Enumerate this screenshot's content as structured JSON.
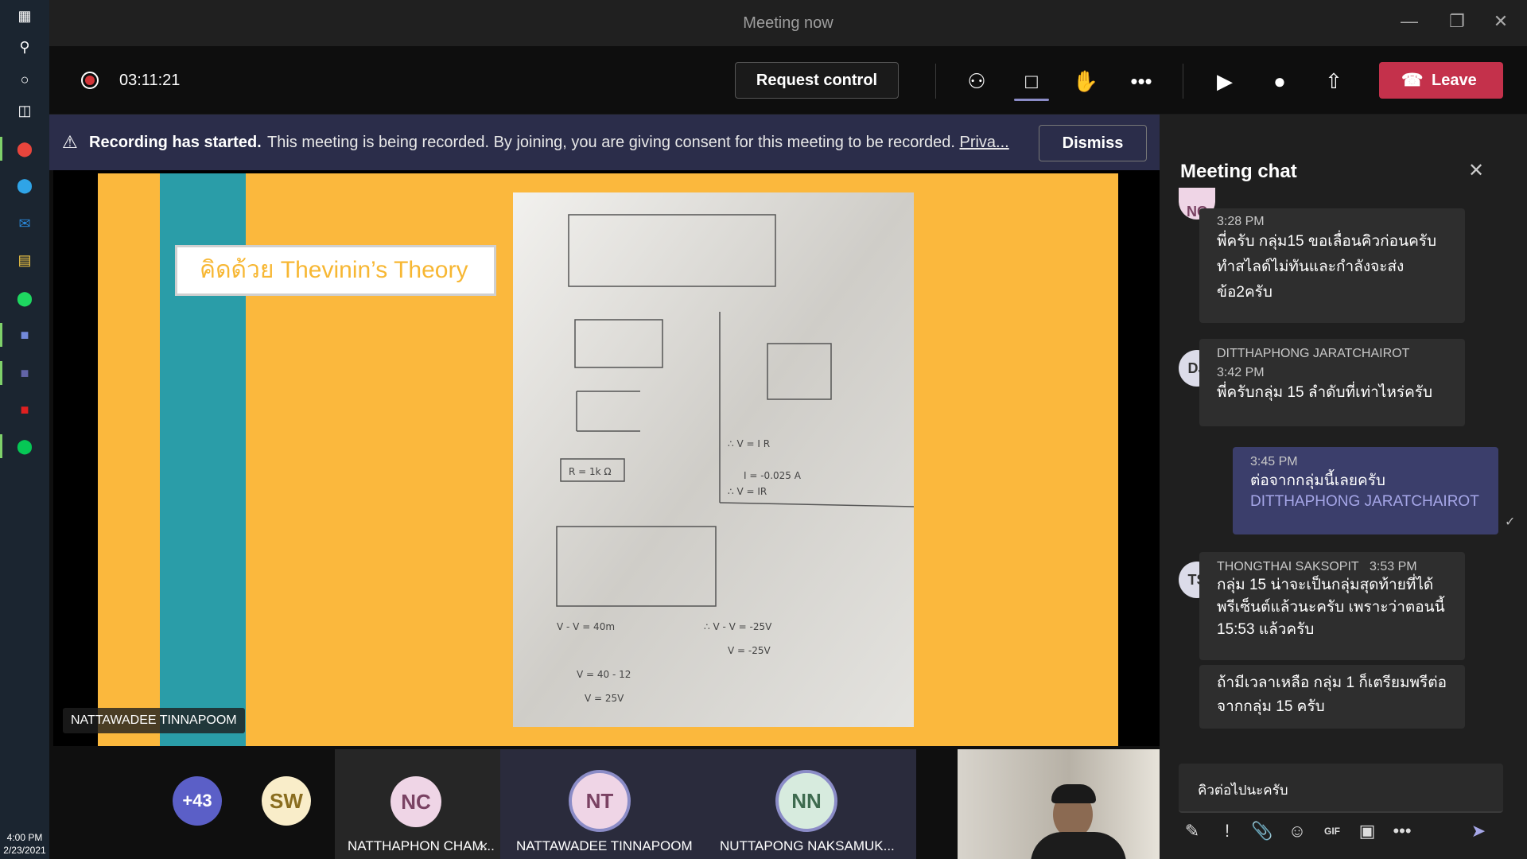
{
  "taskbar": {
    "icons": [
      "windows-icon",
      "search-icon",
      "cortana-icon",
      "task-view-icon",
      "chrome-icon",
      "edge-icon",
      "mail-icon",
      "file-explorer-icon",
      "spotify-icon",
      "discord-icon",
      "teams-icon",
      "acrobat-icon",
      "line-icon"
    ],
    "time": "4:00 PM",
    "date": "2/23/2021"
  },
  "window": {
    "title": "Meeting now"
  },
  "toolbar": {
    "timer": "03:11:21",
    "request_control": "Request control",
    "leave": "Leave"
  },
  "banner": {
    "bold": "Recording has started.",
    "message": "This meeting is being recorded. By joining, you are giving consent for this meeting to be recorded.",
    "link": "Priva...",
    "dismiss": "Dismiss"
  },
  "presentation": {
    "slide_title": "คิดด้วย Thevinin’s Theory",
    "presenter": "NATTAWADEE TINNAPOOM"
  },
  "participants": {
    "overflow": "+43",
    "tiles": [
      {
        "initials": "SW",
        "name": ""
      },
      {
        "initials": "NC",
        "name": "NATTHAPHON CHAM..."
      },
      {
        "initials": "NT",
        "name": "NATTAWADEE TINNAPOOM"
      },
      {
        "initials": "NN",
        "name": "NUTTAPONG NAKSAMUK..."
      }
    ]
  },
  "chat": {
    "title": "Meeting chat",
    "messages": [
      {
        "avatar": "NC",
        "author": "",
        "time": "3:28 PM",
        "text": "พี่ครับ กลุ่ม15 ขอเลื่อนคิวก่อนครับ ทำสไลด์ไม่ทันและกำลังจะส่งข้อ2ครับ"
      },
      {
        "avatar": "DJ",
        "author": "DITTHAPHONG JARATCHAIROT",
        "time": "3:42 PM",
        "text": "พี่ครับกลุ่ม 15 ลำดับที่เท่าไหร่ครับ"
      },
      {
        "avatar": "",
        "author": "",
        "time": "3:45 PM",
        "text": "ต่อจากกลุ่มนี้เลยครับ",
        "mention": "DITTHAPHONG JARATCHAIROT"
      },
      {
        "avatar": "TS",
        "author": "THONGTHAI SAKSOPIT",
        "time": "3:53 PM",
        "text": "กลุ่ม 15 น่าจะเป็นกลุ่มสุดท้ายที่ได้พรีเซ็นต์แล้วนะครับ เพราะว่าตอนนี้ 15:53 แล้วครับ"
      },
      {
        "avatar": "",
        "author": "",
        "time": "",
        "text": "ถ้ามีเวลาเหลือ กลุ่ม 1 ก็เตรียมพรีต่อจากกลุ่ม 15 ครับ"
      }
    ],
    "compose_value": "คิวต่อไปนะครับ"
  }
}
